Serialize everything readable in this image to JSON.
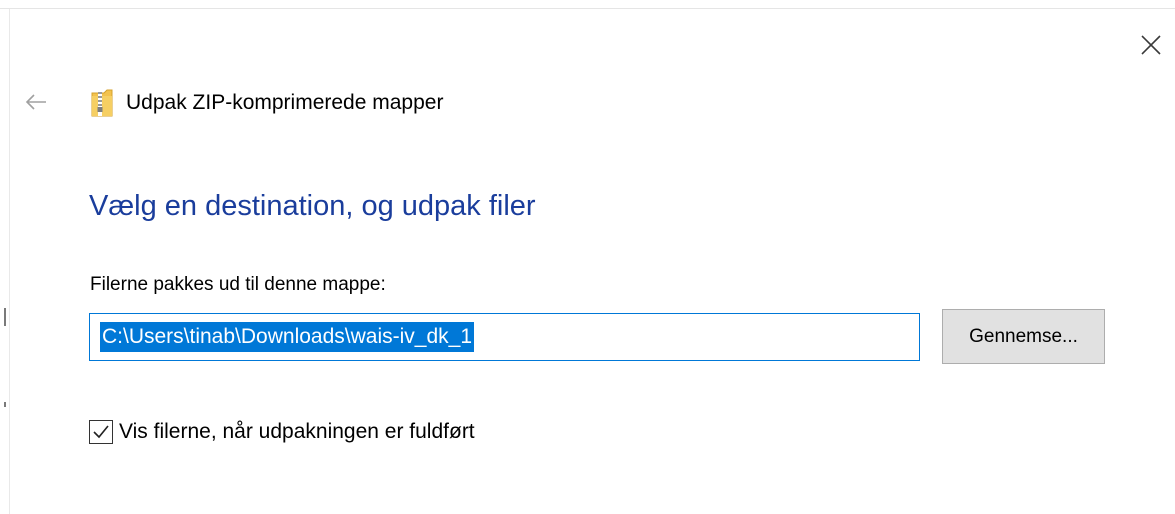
{
  "header": {
    "title": "Udpak ZIP-komprimerede mapper",
    "back_icon": "back-arrow-icon",
    "app_icon": "zip-folder-icon",
    "close_icon": "close-icon"
  },
  "main": {
    "heading": "Vælg en destination, og udpak filer",
    "destination_label": "Filerne pakkes ud til denne mappe:",
    "destination_value": "C:\\Users\\tinab\\Downloads\\wais-iv_dk_1",
    "browse_label": "Gennemse...",
    "show_files_checked": true,
    "show_files_label": "Vis filerne, når udpakningen er fuldført"
  },
  "colors": {
    "heading": "#1a3d9c",
    "accent": "#0078d7",
    "button_bg": "#e1e1e1"
  }
}
